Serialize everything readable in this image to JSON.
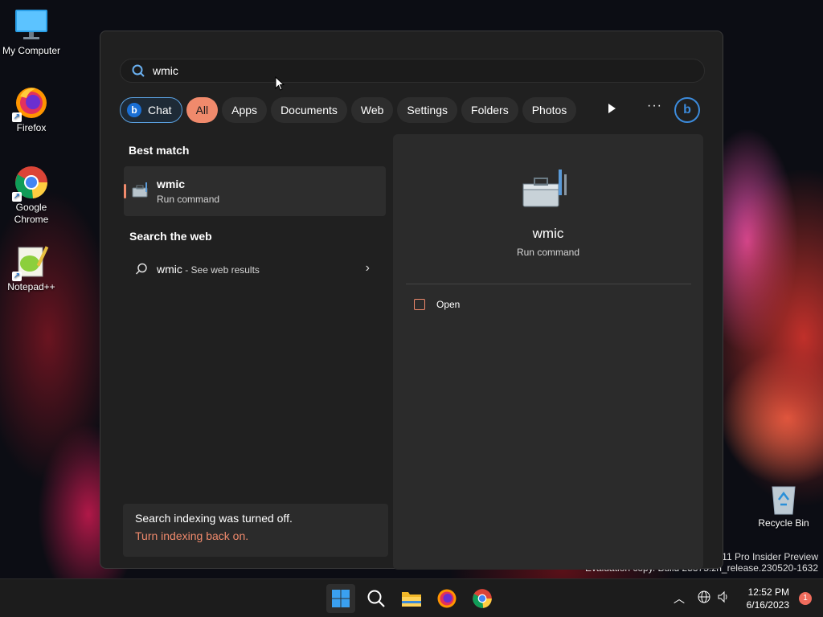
{
  "desktop": {
    "icons": [
      {
        "label": "My Computer",
        "icon": "monitor-icon"
      },
      {
        "label": "Firefox",
        "icon": "firefox-icon"
      },
      {
        "label": "Google Chrome",
        "icon": "chrome-icon"
      },
      {
        "label": "Notepad++",
        "icon": "notepadpp-icon"
      },
      {
        "label": "Recycle Bin",
        "icon": "recycle-bin-icon"
      }
    ],
    "watermark_line1": "s 11 Pro Insider Preview",
    "watermark_line2": "Evaluation copy. Build 25375.zn_release.230520-1632"
  },
  "search": {
    "query": "wmic",
    "filters": [
      "Chat",
      "All",
      "Apps",
      "Documents",
      "Web",
      "Settings",
      "Folders",
      "Photos"
    ],
    "active_filter": "All",
    "more_label": "···"
  },
  "results": {
    "best_match_title": "Best match",
    "best_match": {
      "name": "wmic",
      "type": "Run command"
    },
    "web_title": "Search the web",
    "web_query": "wmic",
    "web_suffix": " - See web results"
  },
  "indexing": {
    "message": "Search indexing was turned off.",
    "link": "Turn indexing back on."
  },
  "detail": {
    "name": "wmic",
    "type": "Run command",
    "open_label": "Open"
  },
  "taskbar": {
    "time": "12:52 PM",
    "date": "6/16/2023",
    "notification_count": "1"
  },
  "colors": {
    "accent": "#f08a6c",
    "bing": "#1a6fd4"
  }
}
